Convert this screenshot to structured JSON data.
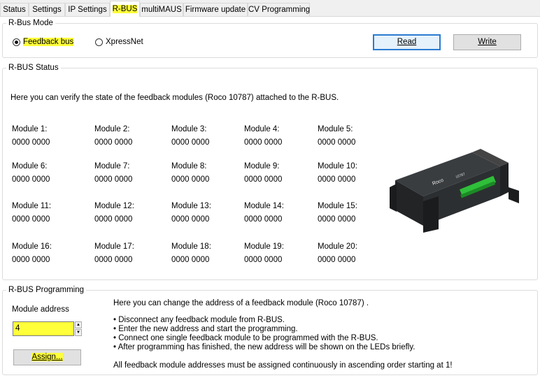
{
  "tabs": [
    {
      "label": "Status"
    },
    {
      "label": "Settings"
    },
    {
      "label": "IP Settings"
    },
    {
      "label": "R-BUS"
    },
    {
      "label": "multiMAUS"
    },
    {
      "label": "Firmware update"
    },
    {
      "label": "CV Programming"
    }
  ],
  "active_tab": "R-BUS",
  "mode": {
    "title": "R-Bus Mode",
    "options": [
      {
        "label": "Feedback bus",
        "selected": true
      },
      {
        "label": "XpressNet",
        "selected": false
      }
    ],
    "read_label": "Read",
    "write_label": "Write"
  },
  "status": {
    "title": "R-BUS Status",
    "description": "Here you can verify the state of the feedback modules (Roco 10787) attached to the R-BUS.",
    "modules": [
      {
        "label": "Module 1:",
        "value": "0000 0000"
      },
      {
        "label": "Module 2:",
        "value": "0000 0000"
      },
      {
        "label": "Module 3:",
        "value": "0000 0000"
      },
      {
        "label": "Module 4:",
        "value": "0000 0000"
      },
      {
        "label": "Module 5:",
        "value": "0000 0000"
      },
      {
        "label": "Module 6:",
        "value": "0000 0000"
      },
      {
        "label": "Module 7:",
        "value": "0000 0000"
      },
      {
        "label": "Module 8:",
        "value": "0000 0000"
      },
      {
        "label": "Module 9:",
        "value": "0000 0000"
      },
      {
        "label": "Module 10:",
        "value": "0000 0000"
      },
      {
        "label": "Module 11:",
        "value": "0000 0000"
      },
      {
        "label": "Module 12:",
        "value": "0000 0000"
      },
      {
        "label": "Module 13:",
        "value": "0000 0000"
      },
      {
        "label": "Module 14:",
        "value": "0000 0000"
      },
      {
        "label": "Module 15:",
        "value": "0000 0000"
      },
      {
        "label": "Module 16:",
        "value": "0000 0000"
      },
      {
        "label": "Module 17:",
        "value": "0000 0000"
      },
      {
        "label": "Module 18:",
        "value": "0000 0000"
      },
      {
        "label": "Module 19:",
        "value": "0000 0000"
      },
      {
        "label": "Module 20:",
        "value": "0000 0000"
      }
    ],
    "device_brand": "Roco",
    "device_model": "10787"
  },
  "programming": {
    "title": "R-BUS Programming",
    "address_label": "Module address",
    "address_value": "4",
    "assign_label": "Assign...",
    "intro": "Here you can change the address of a feedback module (Roco 10787) .",
    "steps": [
      "Disconnect any feedback module from R-BUS.",
      "Enter the new address and start the programming.",
      "Connect one single feedback module to be programmed with the R-BUS.",
      "After programming has finished, the new address will be shown on the LEDs briefly."
    ],
    "note": "All feedback module addresses must be assigned continuously in ascending order starting at 1!"
  },
  "colors": {
    "highlight": "#ffff3a",
    "focus_border": "#2b7bd1"
  }
}
